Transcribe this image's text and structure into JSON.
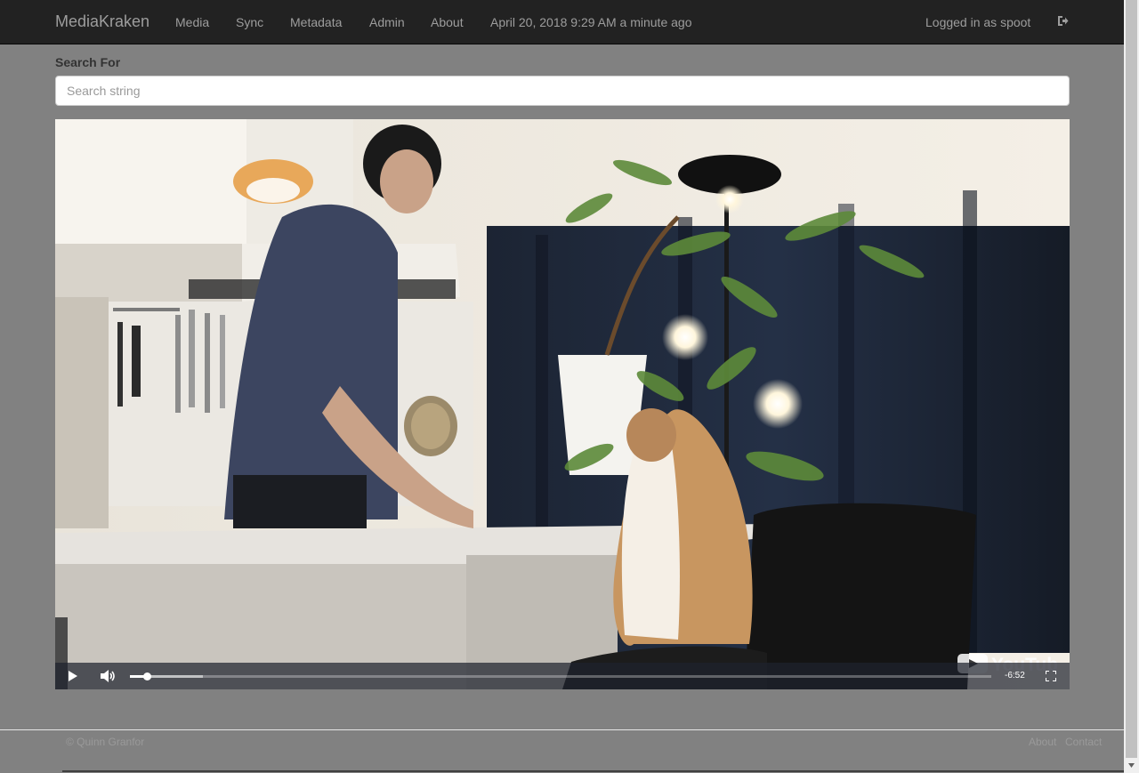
{
  "navbar": {
    "brand": "MediaKraken",
    "links": [
      "Media",
      "Sync",
      "Metadata",
      "Admin",
      "About"
    ],
    "datetime": "April 20, 2018 9:29 AM a minute ago",
    "user": "Logged in as spoot",
    "logout_icon": "sign-out-icon"
  },
  "search": {
    "label": "Search For",
    "placeholder": "Search string",
    "value": ""
  },
  "video": {
    "time_remaining": "-6:52",
    "logo_text": "YouTube",
    "played_fraction": 0.02,
    "buffered_fraction": 0.085,
    "play_icon": "play-icon",
    "volume_icon": "volume-icon",
    "fullscreen_icon": "fullscreen-icon"
  },
  "footer": {
    "copyright": "© Quinn Granfor",
    "links": [
      "About",
      "Contact"
    ]
  }
}
